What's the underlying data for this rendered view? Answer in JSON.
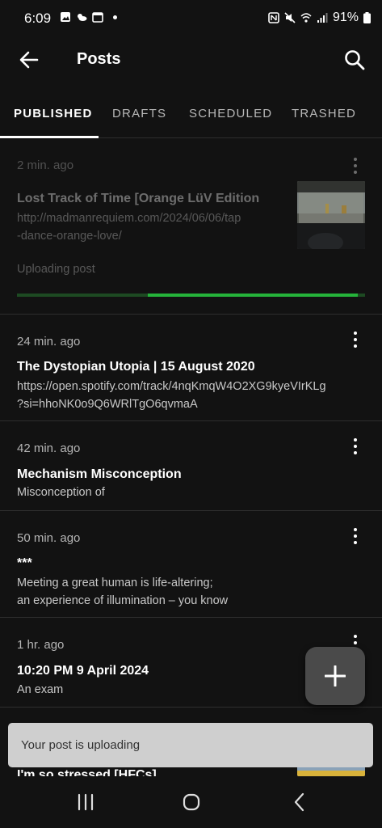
{
  "status_bar": {
    "time": "6:09",
    "battery": "91%"
  },
  "appbar": {
    "title": "Posts",
    "back_icon": "arrow-left-icon",
    "search_icon": "search-icon"
  },
  "tabs": [
    {
      "label": "PUBLISHED",
      "active": true
    },
    {
      "label": "DRAFTS",
      "active": false
    },
    {
      "label": "SCHEDULED",
      "active": false
    },
    {
      "label": "TRASHED",
      "active": false
    }
  ],
  "posts": [
    {
      "time": "2 min. ago",
      "title": "Lost Track of Time [Orange LüV Edition",
      "body_line1": "http://madmanrequiem.com/2024/06/06/tap",
      "body_line2": "-dance-orange-love/",
      "status": "Uploading post",
      "progress": 0.62
    },
    {
      "time": "24 min. ago",
      "title": "The Dystopian Utopia | 15 August 2020",
      "body_line1": "https://open.spotify.com/track/4nqKmqW4O2XG9kyeVIrKLg",
      "body_line2": "?si=hhoNK0o9Q6WRlTgO6qvmaA"
    },
    {
      "time": "42 min. ago",
      "title": "Mechanism Misconception",
      "body_line1": "Misconception of"
    },
    {
      "time": "50 min. ago",
      "title": "***",
      "body_line1": "Meeting a great human is life-altering;",
      "body_line2": "an experience of illumination – you know"
    },
    {
      "time": "1 hr. ago",
      "title": "10:20 PM 9 April 2024",
      "body_line1": "An exam"
    },
    {
      "title": "I'm so stressed [HFCs]"
    }
  ],
  "fab": {
    "icon": "plus-icon"
  },
  "snackbar": {
    "text": "Your post is uploading"
  },
  "navbar": {
    "recents_icon": "recents-icon",
    "home_icon": "home-icon",
    "back_icon": "nav-back-icon"
  },
  "colors": {
    "background": "#121212",
    "accent_progress": "#25b33a",
    "snackbar": "#cfcfcf"
  }
}
